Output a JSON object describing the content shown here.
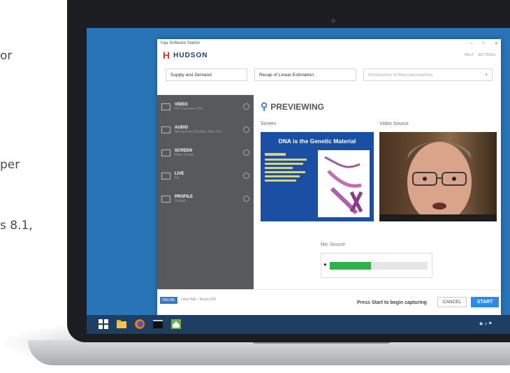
{
  "background_text": {
    "line1": "or",
    "line2": "per",
    "line3": "s 8.1,"
  },
  "window": {
    "title": "Yuja Software Station",
    "controls": [
      "–",
      "□",
      "✕"
    ]
  },
  "header": {
    "brand": "HUDSON",
    "links": [
      "HELP",
      "SETTINGS"
    ]
  },
  "selects": [
    {
      "value": "Supply and Demand"
    },
    {
      "value": "Recap of Linear Estimation"
    },
    {
      "value": "Introduction to Macroeconomics"
    }
  ],
  "sidebar": {
    "items": [
      {
        "title": "VIDEO",
        "sub": "HP Truevision HD",
        "icon": "video-icon"
      },
      {
        "title": "AUDIO",
        "sub": "Microphone (Realtek High Def...",
        "icon": "audio-icon"
      },
      {
        "title": "SCREEN",
        "sub": "Main Screen",
        "icon": "screen-icon"
      },
      {
        "title": "LIVE",
        "sub": "No",
        "icon": "live-icon"
      },
      {
        "title": "PROFILE",
        "sub": "Default",
        "icon": "profile-icon"
      }
    ]
  },
  "main": {
    "heading": "PREVIEWING",
    "screen_label": "Screen",
    "video_label": "Video Source",
    "slide_title": "DNA is the Genetic Material",
    "mic_label": "Mic Source",
    "mic_level": 0.42
  },
  "footer": {
    "status_badge": "ONLINE",
    "location": "Libra Hall – Room 109",
    "message": "Press Start to begin capturing",
    "cancel": "CANCEL",
    "start": "START"
  },
  "colors": {
    "accent": "#2b8be8",
    "sidebar": "#58595b",
    "desktop": "#2874b6",
    "mic": "#2fb24a"
  }
}
